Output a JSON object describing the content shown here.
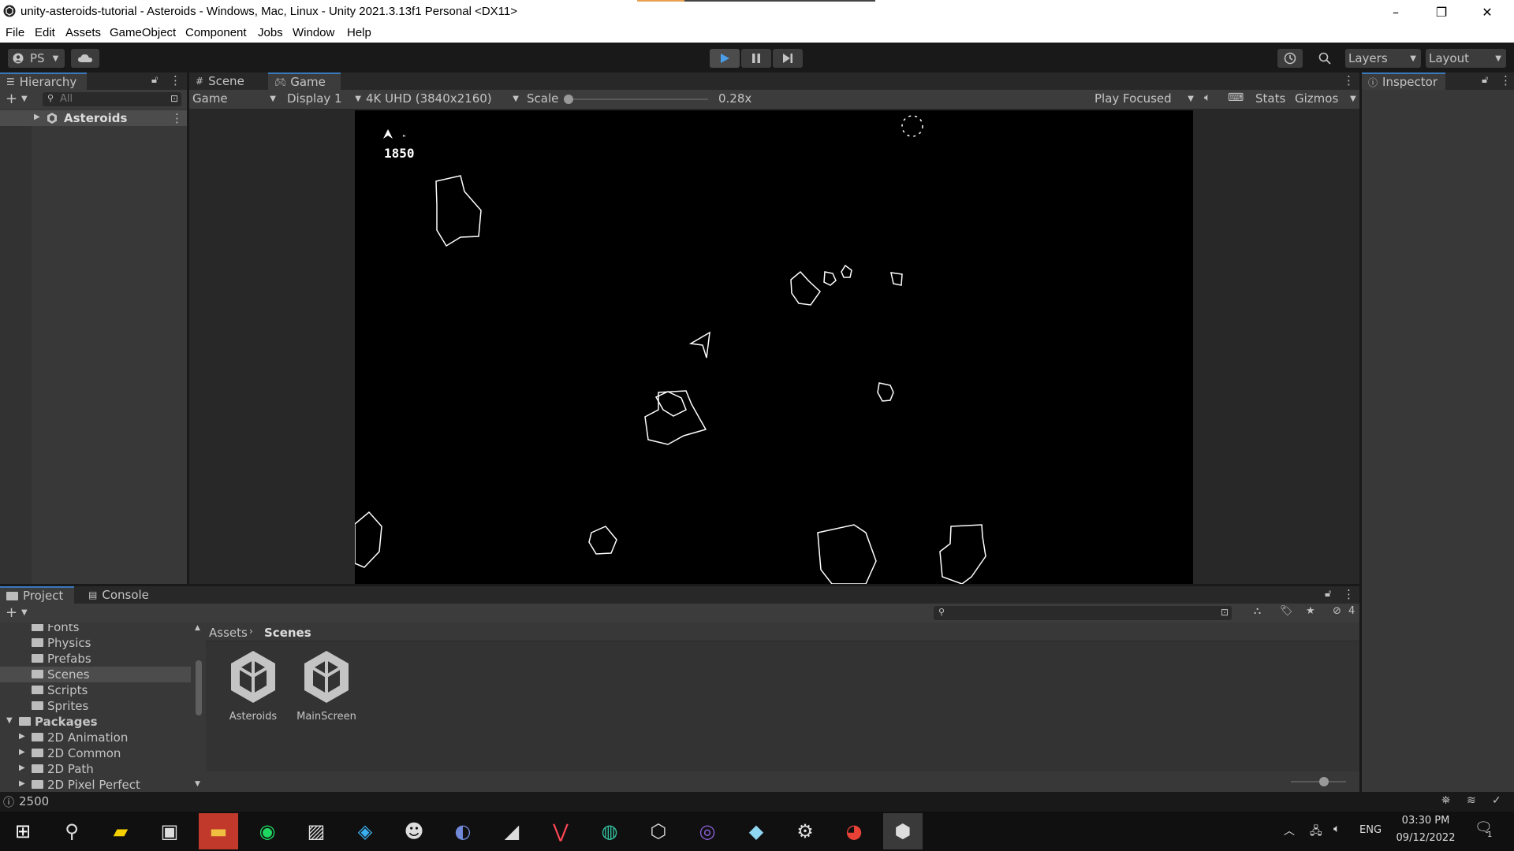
{
  "window": {
    "title": "unity-asteroids-tutorial - Asteroids - Windows, Mac, Linux - Unity 2021.3.13f1 Personal <DX11>",
    "minimize": "–",
    "maximize": "❐",
    "close": "✕"
  },
  "menu": [
    "File",
    "Edit",
    "Assets",
    "GameObject",
    "Component",
    "Jobs",
    "Window",
    "Help"
  ],
  "toolbar": {
    "account": "PS",
    "layers": "Layers",
    "layout": "Layout"
  },
  "hierarchy": {
    "tab": "Hierarchy",
    "search_placeholder": "All",
    "scene_item": "Asteroids"
  },
  "scene_tabs": {
    "scene": "Scene",
    "game": "Game"
  },
  "game_bar": {
    "view": "Game",
    "display": "Display 1",
    "resolution": "4K UHD (3840x2160)",
    "scale_label": "Scale",
    "scale_value": "0.28x",
    "scale_fraction": 0.0,
    "play_mode": "Play Focused",
    "stats": "Stats",
    "gizmos": "Gizmos"
  },
  "game_view": {
    "score": "1850",
    "lives_marker": "\""
  },
  "inspector": {
    "tab": "Inspector"
  },
  "project": {
    "tab_project": "Project",
    "tab_console": "Console",
    "hidden_count": "4",
    "breadcrumb": [
      "Assets",
      "Scenes"
    ],
    "tree": [
      {
        "label": "Fonts",
        "indent": 1,
        "expander": false
      },
      {
        "label": "Physics",
        "indent": 1,
        "expander": false
      },
      {
        "label": "Prefabs",
        "indent": 1,
        "expander": false
      },
      {
        "label": "Scenes",
        "indent": 1,
        "expander": false,
        "selected": true
      },
      {
        "label": "Scripts",
        "indent": 1,
        "expander": false
      },
      {
        "label": "Sprites",
        "indent": 1,
        "expander": false
      },
      {
        "label": "Packages",
        "indent": 0,
        "expander": "open"
      },
      {
        "label": "2D Animation",
        "indent": 1,
        "expander": "closed"
      },
      {
        "label": "2D Common",
        "indent": 1,
        "expander": "closed"
      },
      {
        "label": "2D Path",
        "indent": 1,
        "expander": "closed"
      },
      {
        "label": "2D Pixel Perfect",
        "indent": 1,
        "expander": "closed"
      }
    ],
    "assets": [
      "Asteroids",
      "MainScreen"
    ]
  },
  "status_bar": {
    "message": "2500"
  },
  "taskbar": {
    "apps": [
      "start-icon",
      "search-icon",
      "sticky-notes-icon",
      "media-player-icon",
      "file-explorer-icon",
      "spotify-icon",
      "photos-icon",
      "maps-icon",
      "anime-app-icon",
      "discord-icon",
      "game-app-icon",
      "valorant-icon",
      "edge-icon",
      "unity-hub-icon",
      "github-desktop-icon",
      "paint-icon",
      "settings-icon",
      "chrome-icon",
      "unity-editor-icon"
    ],
    "language": "ENG",
    "time": "03:30 PM",
    "date": "09/12/2022",
    "notification_count": "1"
  },
  "colors": {
    "editor_bg": "#383838",
    "toolbar_bg": "#191919",
    "accent": "#3a79bb",
    "selected": "#2c5d87"
  }
}
